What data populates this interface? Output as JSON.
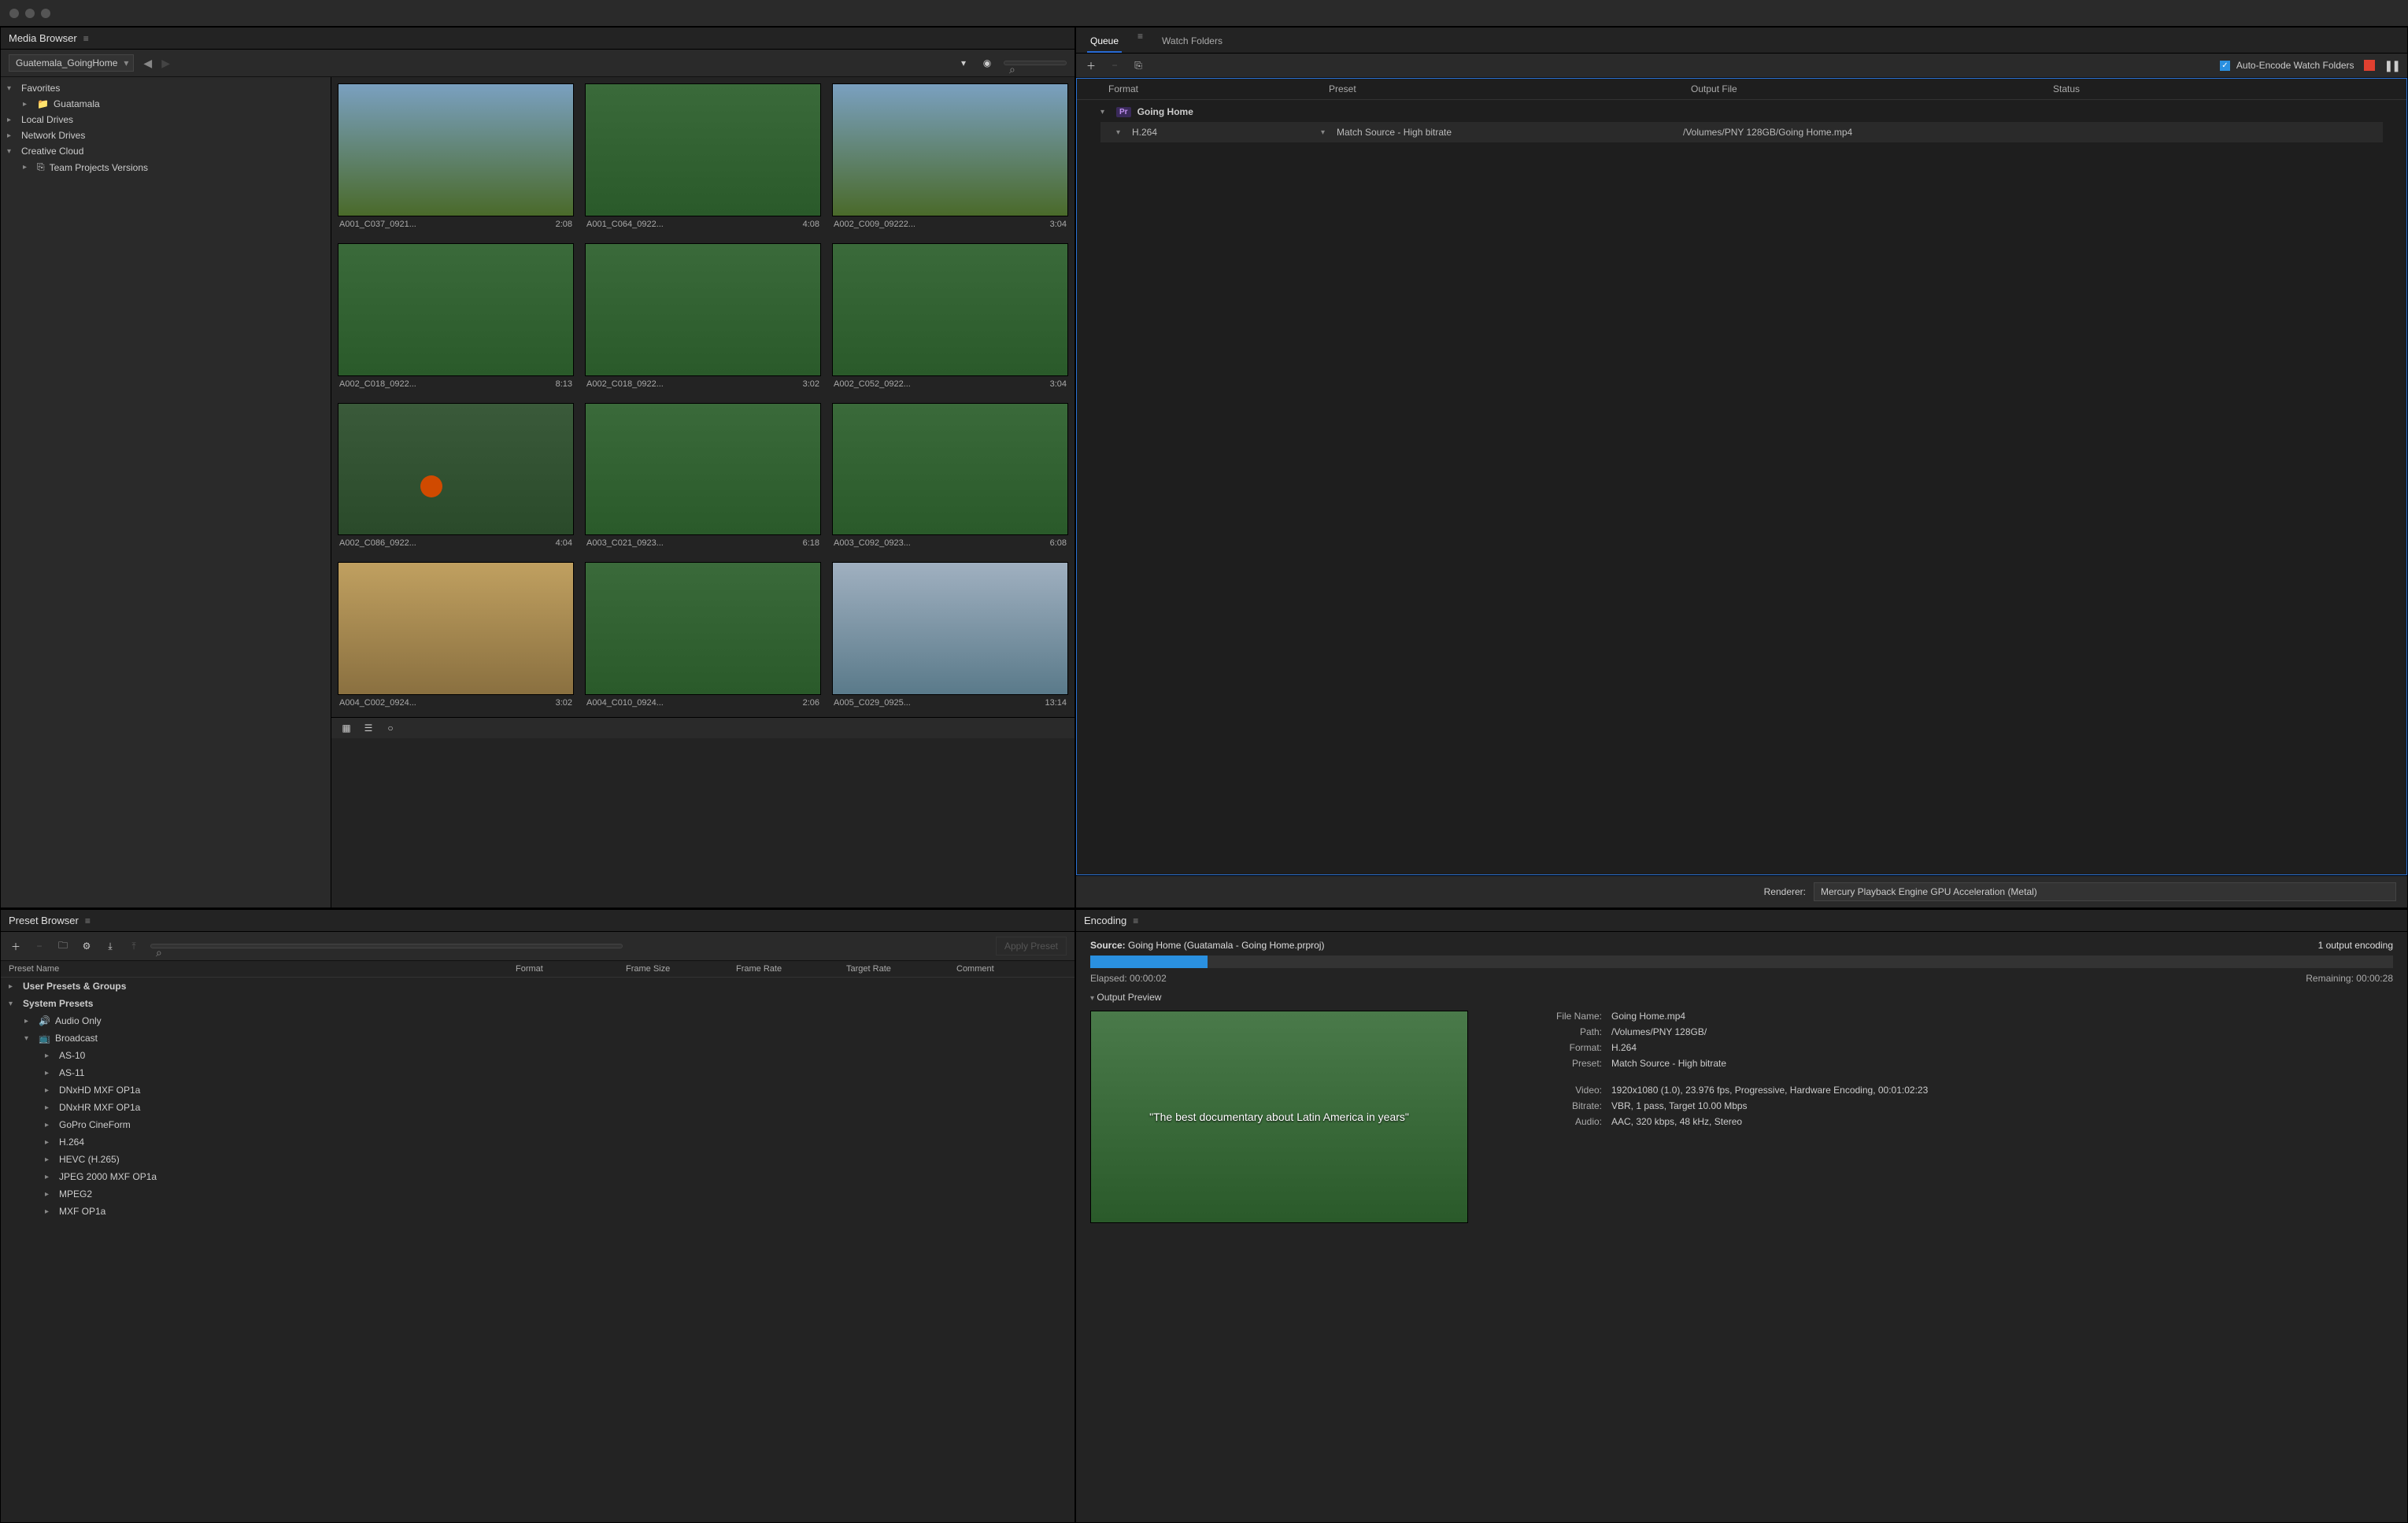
{
  "mediaBrowser": {
    "title": "Media Browser",
    "pathDropdown": "Guatemala_GoingHome",
    "tree": {
      "favorites": "Favorites",
      "guatemala": "Guatamala",
      "localDrives": "Local Drives",
      "networkDrives": "Network Drives",
      "creativeCloud": "Creative Cloud",
      "teamProjects": "Team Projects Versions"
    },
    "clips": [
      {
        "name": "A001_C037_0921...",
        "dur": "2:08",
        "cls": "sky"
      },
      {
        "name": "A001_C064_0922...",
        "dur": "4:08",
        "cls": "green"
      },
      {
        "name": "A002_C009_09222...",
        "dur": "3:04",
        "cls": "sky"
      },
      {
        "name": "A002_C018_0922...",
        "dur": "8:13",
        "cls": "green"
      },
      {
        "name": "A002_C018_0922...",
        "dur": "3:02",
        "cls": "green"
      },
      {
        "name": "A002_C052_0922...",
        "dur": "3:04",
        "cls": "green"
      },
      {
        "name": "A002_C086_0922...",
        "dur": "4:04",
        "cls": "ball"
      },
      {
        "name": "A003_C021_0923...",
        "dur": "6:18",
        "cls": "green"
      },
      {
        "name": "A003_C092_0923...",
        "dur": "6:08",
        "cls": "green"
      },
      {
        "name": "A004_C002_0924...",
        "dur": "3:02",
        "cls": "arch"
      },
      {
        "name": "A004_C010_0924...",
        "dur": "2:06",
        "cls": "green"
      },
      {
        "name": "A005_C029_0925...",
        "dur": "13:14",
        "cls": "lake"
      }
    ]
  },
  "queue": {
    "tabs": {
      "queue": "Queue",
      "watch": "Watch Folders"
    },
    "autoEncode": "Auto-Encode Watch Folders",
    "headers": {
      "format": "Format",
      "preset": "Preset",
      "output": "Output File",
      "status": "Status"
    },
    "job": {
      "title": "Going Home",
      "format": "H.264",
      "preset": "Match Source - High bitrate",
      "output": "/Volumes/PNY 128GB/Going Home.mp4"
    },
    "rendererLabel": "Renderer:",
    "renderer": "Mercury Playback Engine GPU Acceleration (Metal)"
  },
  "presetBrowser": {
    "title": "Preset Browser",
    "applyBtn": "Apply Preset",
    "cols": {
      "name": "Preset Name",
      "format": "Format",
      "frameSize": "Frame Size",
      "frameRate": "Frame Rate",
      "targetRate": "Target Rate",
      "comment": "Comment"
    },
    "groups": {
      "user": "User Presets & Groups",
      "system": "System Presets",
      "audioOnly": "Audio Only",
      "broadcast": "Broadcast"
    },
    "items": [
      "AS-10",
      "AS-11",
      "DNxHD MXF OP1a",
      "DNxHR MXF OP1a",
      "GoPro CineForm",
      "H.264",
      "HEVC (H.265)",
      "JPEG 2000 MXF OP1a",
      "MPEG2",
      "MXF OP1a"
    ]
  },
  "encoding": {
    "title": "Encoding",
    "sourceLabel": "Source:",
    "source": "Going Home (Guatamala - Going Home.prproj)",
    "outputCount": "1 output encoding",
    "elapsedLabel": "Elapsed:",
    "elapsed": "00:00:02",
    "remainingLabel": "Remaining:",
    "remaining": "00:00:28",
    "previewLabel": "Output Preview",
    "previewText": "\"The best documentary about Latin America in years\"",
    "meta": {
      "fileNameLbl": "File Name:",
      "fileName": "Going Home.mp4",
      "pathLbl": "Path:",
      "path": "/Volumes/PNY 128GB/",
      "formatLbl": "Format:",
      "format": "H.264",
      "presetLbl": "Preset:",
      "preset": "Match Source - High bitrate",
      "videoLbl": "Video:",
      "video": "1920x1080 (1.0), 23.976 fps, Progressive, Hardware Encoding, 00:01:02:23",
      "bitrateLbl": "Bitrate:",
      "bitrate": "VBR, 1 pass, Target 10.00 Mbps",
      "audioLbl": "Audio:",
      "audio": "AAC, 320 kbps, 48 kHz, Stereo"
    }
  }
}
